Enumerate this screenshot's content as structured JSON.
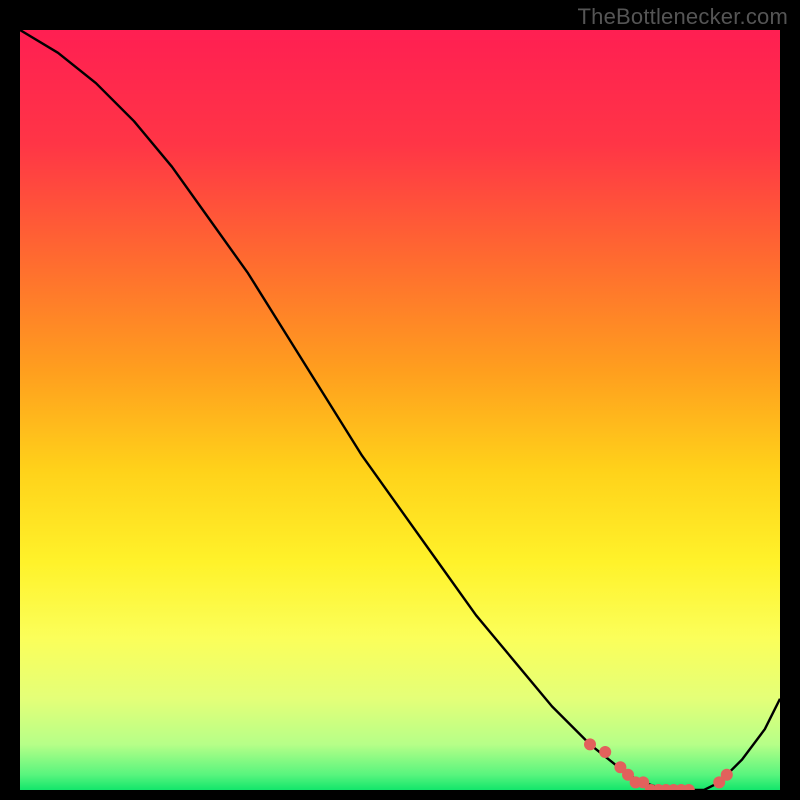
{
  "watermark": "TheBottlenecker.com",
  "chart_data": {
    "type": "line",
    "title": "",
    "xlabel": "",
    "ylabel": "",
    "xlim": [
      0,
      100
    ],
    "ylim": [
      0,
      100
    ],
    "x": [
      0,
      5,
      10,
      15,
      20,
      25,
      30,
      35,
      40,
      45,
      50,
      55,
      60,
      65,
      70,
      75,
      80,
      82,
      85,
      88,
      90,
      92,
      95,
      98,
      100
    ],
    "values": [
      100,
      97,
      93,
      88,
      82,
      75,
      68,
      60,
      52,
      44,
      37,
      30,
      23,
      17,
      11,
      6,
      2,
      1,
      0,
      0,
      0,
      1,
      4,
      8,
      12
    ],
    "marker_x": [
      75,
      77,
      79,
      80,
      81,
      82,
      83,
      84,
      85,
      86,
      87,
      88,
      92,
      93
    ],
    "marker_values": [
      6,
      5,
      3,
      2,
      1,
      1,
      0,
      0,
      0,
      0,
      0,
      0,
      1,
      2
    ],
    "gradient_stops": [
      {
        "offset": 0.0,
        "color": "#ff1f52"
      },
      {
        "offset": 0.15,
        "color": "#ff3546"
      },
      {
        "offset": 0.3,
        "color": "#ff6a30"
      },
      {
        "offset": 0.45,
        "color": "#ff9f1e"
      },
      {
        "offset": 0.58,
        "color": "#ffd21a"
      },
      {
        "offset": 0.7,
        "color": "#fff22a"
      },
      {
        "offset": 0.8,
        "color": "#fbff5a"
      },
      {
        "offset": 0.88,
        "color": "#e4ff78"
      },
      {
        "offset": 0.94,
        "color": "#b6ff88"
      },
      {
        "offset": 0.98,
        "color": "#58f57e"
      },
      {
        "offset": 1.0,
        "color": "#13e66b"
      }
    ],
    "line_color": "#000000",
    "marker_color": "#e2615c"
  }
}
